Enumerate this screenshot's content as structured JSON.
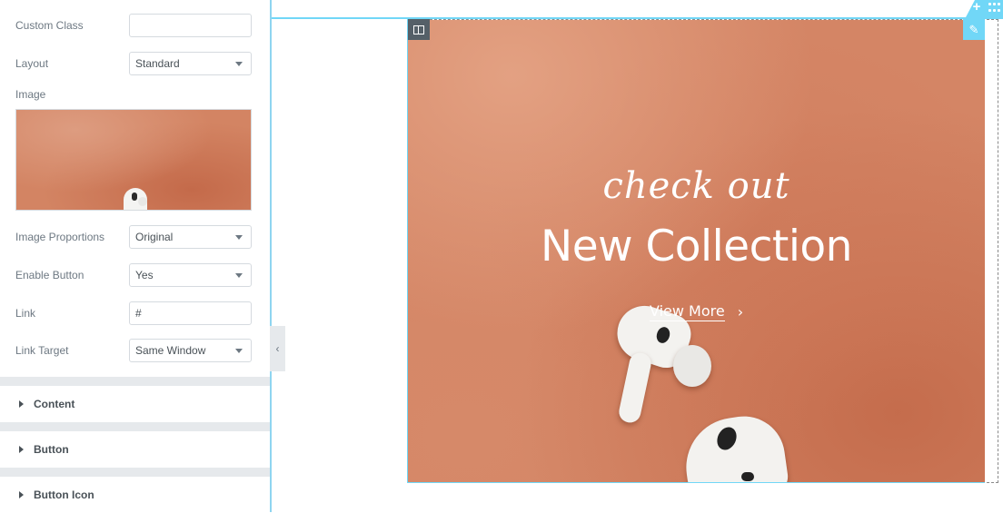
{
  "panel": {
    "fields": [
      {
        "label": "Custom Class",
        "value": "",
        "type": "text"
      },
      {
        "label": "Layout",
        "value": "Standard",
        "type": "select"
      },
      {
        "label": "Image",
        "value": "",
        "type": "image"
      },
      {
        "label": "Image Proportions",
        "value": "Original",
        "type": "select"
      },
      {
        "label": "Enable Button",
        "value": "Yes",
        "type": "select"
      },
      {
        "label": "Link",
        "value": "#",
        "type": "text"
      },
      {
        "label": "Link Target",
        "value": "Same Window",
        "type": "select"
      }
    ],
    "sections": [
      {
        "title": "Content"
      },
      {
        "title": "Button"
      },
      {
        "title": "Button Icon"
      }
    ],
    "collapse_icon": "chevron-left-icon"
  },
  "banner": {
    "subheading": "check out",
    "heading": "New Collection",
    "button_label": "View More",
    "button_icon": "chevron-right-icon"
  },
  "handles": {
    "section_add_icon": "plus-icon",
    "section_drag_icon": "drag-grid-icon",
    "column_icon": "column-icon",
    "edit_icon": "pencil-icon"
  },
  "colors": {
    "accent": "#71d7f7",
    "banner_bg": "#d48565",
    "panel_text": "#6d7882"
  }
}
